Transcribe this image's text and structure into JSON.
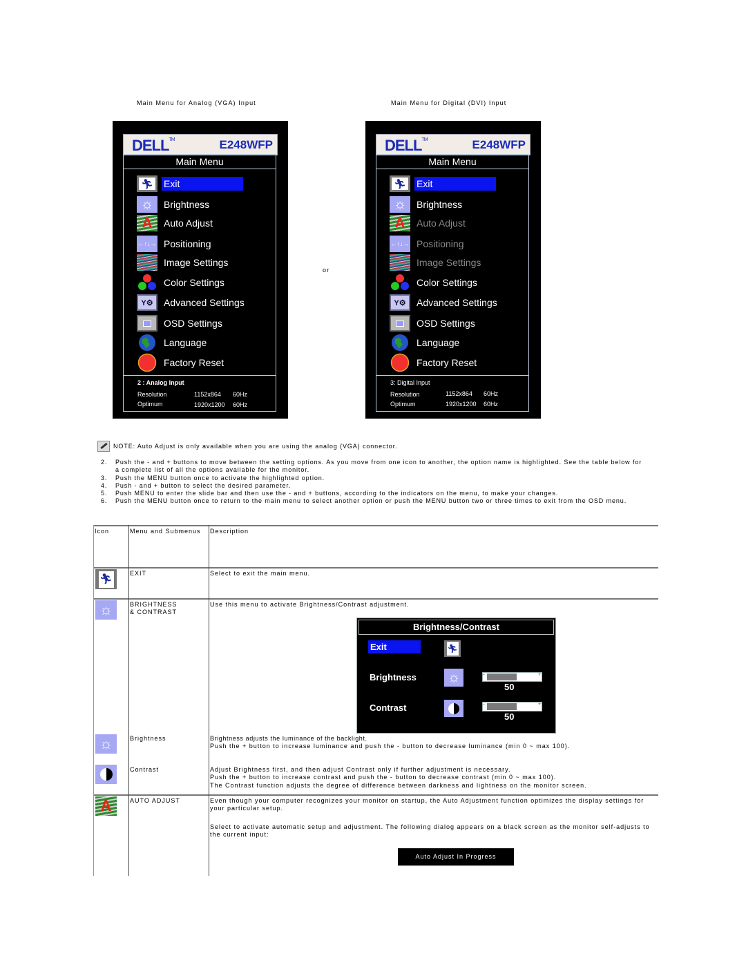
{
  "captions": {
    "analog": "Main Menu for Analog (VGA) Input",
    "digital": "Main Menu for Digital (DVI) Input",
    "or": "or"
  },
  "osd_common": {
    "brand": "DELL",
    "trademark": "TM",
    "model": "E248WFP",
    "menu_title": "Main Menu",
    "items": [
      "Exit",
      "Brightness",
      "Auto Adjust",
      "Positioning",
      "Image Settings",
      "Color Settings",
      "Advanced Settings",
      "OSD Settings",
      "Language",
      "Factory Reset"
    ]
  },
  "osd_analog": {
    "input": "2 : Analog Input",
    "resolution_label": "Resolution",
    "resolution_value": "1152x864",
    "resolution_hz": "60Hz",
    "optimum_label": "Optimum",
    "optimum_value": "1920x1200",
    "optimum_hz": "60Hz",
    "disabled_items": []
  },
  "osd_digital": {
    "input": "3: Digital Input",
    "resolution_label": "Resolution",
    "resolution_value": "1152x864",
    "resolution_hz": "60Hz",
    "optimum_label": "Optimum",
    "optimum_value": "1920x1200",
    "optimum_hz": "60Hz",
    "disabled_items": [
      "Auto Adjust",
      "Positioning",
      "Image Settings"
    ]
  },
  "note": "NOTE: Auto Adjust is only available when you are using the analog (VGA) connector.",
  "steps": [
    {
      "n": "2.",
      "text": "Push the - and + buttons to move between the setting options. As you move from one icon to another, the option name is highlighted. See the table below for a complete list of all the options available for the monitor."
    },
    {
      "n": "3.",
      "text": "Push the MENU button once to activate the highlighted option."
    },
    {
      "n": "4.",
      "text": "Push - and + button to select the desired parameter."
    },
    {
      "n": "5.",
      "text": "Push MENU to enter the slide bar and then use the - and + buttons, according to the indicators on the menu, to make your changes."
    },
    {
      "n": "6.",
      "text": "Push the MENU button once to return to the main menu to select another option or push the MENU button two or three times to exit from the OSD menu."
    }
  ],
  "table": {
    "headers": [
      "Icon",
      "Menu and Submenus",
      "Description"
    ],
    "rows": {
      "exit": {
        "menu": "EXIT",
        "desc": "Select to exit the main menu."
      },
      "brightness_contrast": {
        "menu_line1": "BRIGHTNESS",
        "menu_line2": "& CONTRAST",
        "desc": "Use this menu to activate Brightness/Contrast adjustment."
      },
      "brightness": {
        "menu": "Brightness",
        "desc1": "Brightness adjusts the luminance of the backlight.",
        "desc2": "Push the + button to increase luminance and push the - button to decrease luminance (min 0 ~ max 100)."
      },
      "contrast": {
        "menu": "Contrast",
        "desc1": "Adjust Brightness first, and then adjust Contrast only if further adjustment is necessary.",
        "desc2": "Push the + button to increase contrast and push the - button to decrease contrast (min 0 ~ max 100).",
        "desc3": "The Contrast function adjusts the degree of difference between darkness and lightness on the monitor screen."
      },
      "auto_adjust": {
        "menu": "AUTO ADJUST",
        "desc1": "Even though your computer recognizes your monitor on startup, the Auto Adjustment function optimizes the display settings for your particular setup.",
        "desc2": "Select to activate automatic setup and adjustment. The following dialog appears on a black screen as the monitor self-adjusts to the current input:",
        "dialog": "Auto Adjust In Progress"
      }
    }
  },
  "bc_osd": {
    "title": "Brightness/Contrast",
    "exit": "Exit",
    "brightness": "Brightness",
    "contrast": "Contrast",
    "brightness_value": "50",
    "contrast_value": "50",
    "brightness_level": 50,
    "contrast_level": 50,
    "minus": "-",
    "plus": "+"
  },
  "colors": {
    "highlight": "#0a14f0",
    "brand_blue": "#1a2bb8"
  }
}
